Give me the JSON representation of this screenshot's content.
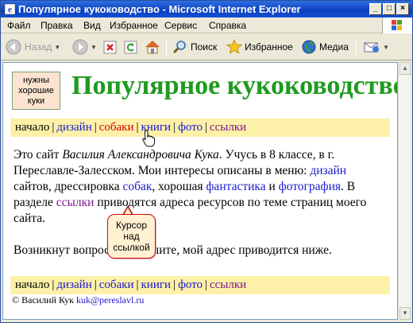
{
  "window": {
    "title": "Популярное кукоководство - Microsoft Internet Explorer",
    "controls": [
      "_",
      "□",
      "×"
    ]
  },
  "menu": {
    "items": [
      "Файл",
      "Правка",
      "Вид",
      "Избранное",
      "Сервис",
      "Справка"
    ]
  },
  "toolbar": {
    "back": "Назад",
    "search": "Поиск",
    "favorites": "Избранное",
    "media": "Медиа"
  },
  "page": {
    "logo_lines": [
      "нужны",
      "хорошие",
      "куки"
    ],
    "title": "Популярное кукоководство",
    "nav": {
      "current": "начало",
      "links": [
        "дизайн",
        "собаки",
        "книги",
        "фото",
        "ссылки"
      ]
    },
    "intro": {
      "t1": "Это сайт ",
      "author": "Василия Александровича Кука",
      "t2": ". Учусь в 8 классе, в г. Переславле-Залесском. Мои интересы описаны в меню: ",
      "link_design": "дизайн",
      "t3": " сайтов, дрессировка ",
      "link_dogs": "собак",
      "t4": ", хорошая ",
      "link_fantasy": "фантастика",
      "t5": " и ",
      "link_photo": "фотография",
      "t6": ". В разделе ",
      "link_links": "ссылки",
      "t7": " приводятся адреса ресурсов по теме страниц моего сайта."
    },
    "closing": "Возникнут вопросы — пишите, мой адрес приводится ниже.",
    "footer": {
      "copyright": "© Василий Кук ",
      "email": "kuk@pereslavl.ru"
    },
    "tooltip_lines": [
      "Курсор",
      "над",
      "ссылкой"
    ]
  },
  "colors": {
    "title_green": "#1f9a1f",
    "nav_bg": "#fdf0a8",
    "link_blue": "#1a1acc",
    "link_hover_red": "#d40000",
    "link_visited": "#7a1a8a",
    "logo_bg": "#fbe3cf",
    "tooltip_border": "#c50d0d"
  }
}
